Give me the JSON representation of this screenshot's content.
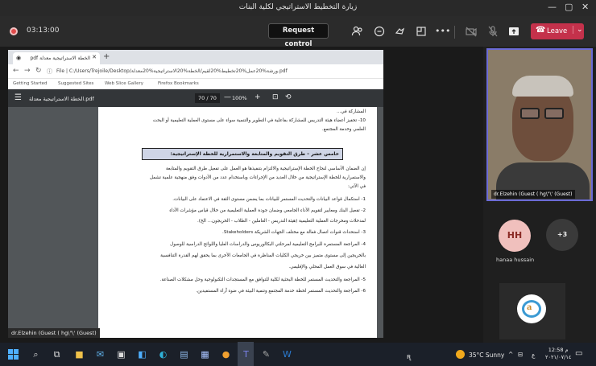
{
  "window": {
    "title": "زيارة التخطيط الاستراتيجي لكلية البنات",
    "minimize": "—",
    "maximize": "▢",
    "close": "✕"
  },
  "meeting": {
    "timer": "03:13:00",
    "request_control": "Request control",
    "leave": "Leave",
    "icons": [
      "people-icon",
      "chat-icon",
      "reactions-icon",
      "rooms-icon",
      "more-icon",
      "camera-icon",
      "mic-icon",
      "share-icon"
    ]
  },
  "browser": {
    "tab_label": "pdf الخطة الاستراتيجية معدلة",
    "new_tab": "+",
    "url": "File | C:/Users/Trejoile/Desktop/ورشة%20عمل%20تخطيط%20لقيم/الخطة%20الاستراتيجية%20معدلة.pdf",
    "bookmarks": [
      "Getting Started",
      "Suggested Sites",
      "Web Slice Gallery",
      "Firefox Bookmarks"
    ]
  },
  "pdf": {
    "file_name": "الخطة الاستراتيجية معدلة.pdf",
    "page_indicator": "70 / 70",
    "zoom": "100%",
    "top_lines": [
      "المشاركة في...",
      "10- تحفيز أعضاء هيئة التدريس للمشاركة بفاعلية في التطوير والتنمية سواء على مستوى العملية التعليمية أو البحث",
      "العلمي وخدمة المجتمع."
    ],
    "section_heading": "خامس عشر – طرق التقويم والمتابعة والاستمرارية للخطة الإستراتيجية:",
    "intro_lines": [
      "إن الضمان الأساسي لنجاح الخطة الإستراتيجية والالتزام بتنفيذها هو العمل على تفعيل طرق التقويم والمتابعة",
      "والاستمرارية للخطة الإستراتيجية من خلال العديد من الإجراءات وباستخدام عدد من الأدوات وفق منهجية علمية تشمل",
      "في الآتي:"
    ],
    "items": [
      "1- استكمال قواعد البيانات والتحديث المستمر للبيانات بما يضمن مستوى الثقة في الاعتماد على البيانات.",
      "2- تفعيل البنك ومعايير لتقويم الأداء الجامعي وضمان جودة العملية التعليمية من خلال قياس مؤشرات الأداء",
      "لمدخلات ومخرجات العملية التعليمية (هيئة التدريس - العاملين - الطلاب - الخريجون... الخ).",
      "3- استحداث قنوات اتصال فعالة مع مختلف الجهات الشريكة Stakeholders.",
      "4- المراجعة المستمرة للبرامج التعليمية لمرحلتي البكالوريوس والدراسات العليا واللوائح الدراسية للوصول",
      "بالخريجين إلى مستوى متميز بين خريجي الكليات المناظرة في الجامعات الأخرى بما يحقق لهم القدرة التنافسية",
      "العالية في سوق العمل المحلي والإقليمي.",
      "5- المراجعة والتحديث المستمر للخطة البحثية لكلية للتوافق مع المستجدات التكنولوجية وحل مشكلات الصناعة.",
      "6- المراجعة والتحديث المستمر لخطة خدمة المجتمع وتنمية البيئة في ضوء آراء المستفيدين."
    ]
  },
  "participants": {
    "presenter_tag": "dr.Elzehin (Guest ( hg\\\"\\' (Guest)",
    "video_name": "dr.Elzehin (Guest ( hg\\\"\\' (Guest)",
    "avatar_initials": "HH",
    "avatar_name": "hanaa hussain",
    "more_count": "+3"
  },
  "taskbar": {
    "weather": "35°C Sunny",
    "time": "12:58 م",
    "date": "٢٠٢١/٠٧/١٤",
    "lang": "ع"
  },
  "colors": {
    "leave": "#c4314b",
    "accent_border": "#6b6bd6",
    "section_heading_bg": "#cfd5e6",
    "taskbar": "#1b2029"
  }
}
